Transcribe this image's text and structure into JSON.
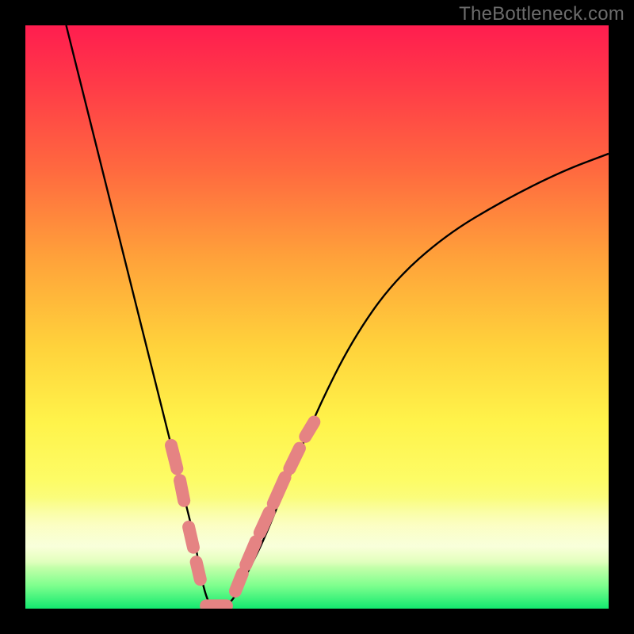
{
  "watermark": "TheBottleneck.com",
  "colors": {
    "frame_bg": "#000000",
    "curve_stroke": "#000000",
    "annotation_stroke": "#e58383",
    "gradient_top": "#ff1d4f",
    "gradient_bottom": "#13e96f"
  },
  "chart_data": {
    "type": "line",
    "title": "",
    "xlabel": "",
    "ylabel": "",
    "xlim": [
      0,
      100
    ],
    "ylim": [
      0,
      100
    ],
    "grid": false,
    "legend": false,
    "series": [
      {
        "name": "bottleneck-curve",
        "x": [
          7,
          10,
          14,
          18,
          22,
          25,
          27,
          29,
          30,
          31,
          32,
          33,
          34,
          36,
          38,
          41,
          45,
          50,
          56,
          63,
          72,
          82,
          92,
          100
        ],
        "y": [
          100,
          88,
          72,
          56,
          40,
          28,
          20,
          12,
          6,
          2,
          0,
          0,
          0,
          2,
          6,
          12,
          22,
          34,
          46,
          56,
          64,
          70,
          75,
          78
        ]
      }
    ],
    "annotations": [
      {
        "name": "left-cluster-upper",
        "segments": [
          [
            25,
            28,
            26,
            24
          ],
          [
            26.5,
            22,
            27.2,
            18.5
          ]
        ]
      },
      {
        "name": "left-cluster-lower",
        "segments": [
          [
            28,
            14,
            28.8,
            10.5
          ],
          [
            29.3,
            8,
            30,
            5
          ]
        ]
      },
      {
        "name": "trough",
        "segments": [
          [
            31,
            0.5,
            34.5,
            0.5
          ]
        ]
      },
      {
        "name": "right-cluster-lower",
        "segments": [
          [
            36,
            3,
            37.2,
            6
          ],
          [
            37.8,
            7.5,
            39.5,
            11.5
          ],
          [
            40.2,
            13,
            41.8,
            16.5
          ]
        ]
      },
      {
        "name": "right-cluster-upper",
        "segments": [
          [
            42.5,
            18,
            44.5,
            22.5
          ],
          [
            45.3,
            24,
            47,
            27.5
          ],
          [
            48,
            29.5,
            49.5,
            32
          ]
        ]
      }
    ],
    "background_gradient_direction": "top-to-bottom"
  }
}
